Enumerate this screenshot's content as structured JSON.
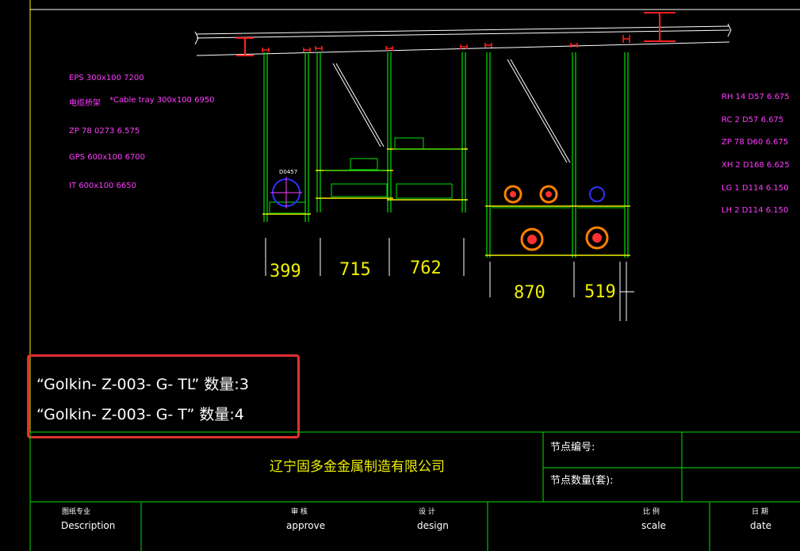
{
  "left_legend": {
    "eps": "EPS 300x100 7200",
    "cable_tray_cn": "电缆桥架",
    "cable_tray": "*Cable tray 300x100 6950",
    "zp": "ZP 78 0273 6.575",
    "gps": "GPS 600x100 6700",
    "it": "IT 600x100 6650"
  },
  "right_legend": {
    "rh": "RH 14 D57 6.675",
    "rc": "RC 2 D57 6.675",
    "zp": "ZP 78 D60 6.675",
    "xh": "XH 2 D168 6.625",
    "lg": "LG 1 D114 6.150",
    "lh": "LH 2 D114 6.150"
  },
  "pipe_tag": "D0457",
  "dimensions": [
    "399",
    "715",
    "762",
    "870",
    "519"
  ],
  "notes": {
    "line1": "“Golkin- Z-003- G- TL” 数量:3",
    "line2": "“Golkin- Z-003- G- T” 数量:4"
  },
  "title_block": {
    "company": "辽宁固多金金属制造有限公司",
    "node_number_label": "节点编号:",
    "node_qty_label": "节点数量(套):",
    "col1_cn": "图纸专业",
    "col1_en": "Description",
    "col2_cn": "审 核",
    "col2_en": "approve",
    "col3_cn": "设 计",
    "col3_en": "design",
    "col4_cn": "比 例",
    "col4_en": "scale",
    "col5_cn": "日 期",
    "col5_en": "date"
  },
  "colors": {
    "background": "#000000",
    "green": "#00e000",
    "yellow": "#f0f000",
    "white": "#ffffff",
    "red": "#ff2020",
    "magenta": "#ff3cff",
    "blue": "#3030ff",
    "orange": "#ff8000",
    "highlight": "#e03030"
  }
}
